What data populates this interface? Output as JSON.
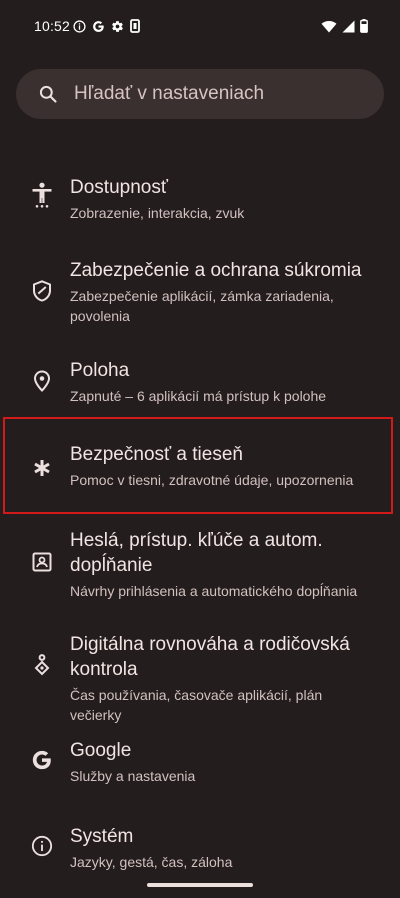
{
  "status_bar": {
    "time": "10:52"
  },
  "search": {
    "placeholder": "Hľadať v nastaveniach"
  },
  "settings": [
    {
      "title": "Dostupnosť",
      "subtitle": "Zobrazenie, interakcia, zvuk",
      "icon": "accessibility-icon"
    },
    {
      "title": "Zabezpečenie a ochrana súkromia",
      "subtitle": "Zabezpečenie aplikácií, zámka zariadenia, povolenia",
      "icon": "shield-icon"
    },
    {
      "title": "Poloha",
      "subtitle": "Zapnuté – 6 aplikácií má prístup k polohe",
      "icon": "location-pin-icon"
    },
    {
      "title": "Bezpečnosť a tieseň",
      "subtitle": "Pomoc v tiesni, zdravotné údaje, upozornenia",
      "icon": "asterisk-icon"
    },
    {
      "title": "Heslá, prístup. kľúče a autom. dopĺňanie",
      "subtitle": "Návrhy prihlásenia a automatického dopĺňania",
      "icon": "person-card-icon"
    },
    {
      "title": "Digitálna rovnováha a rodičovská kontrola",
      "subtitle": "Čas používania, časovače aplikácií, plán večierky",
      "icon": "wellbeing-icon"
    },
    {
      "title": "Google",
      "subtitle": "Služby a nastavenia",
      "icon": "google-icon"
    },
    {
      "title": "Systém",
      "subtitle": "Jazyky, gestá, čas, záloha",
      "icon": "info-icon"
    }
  ],
  "highlight": {
    "color": "#d11a1a"
  }
}
